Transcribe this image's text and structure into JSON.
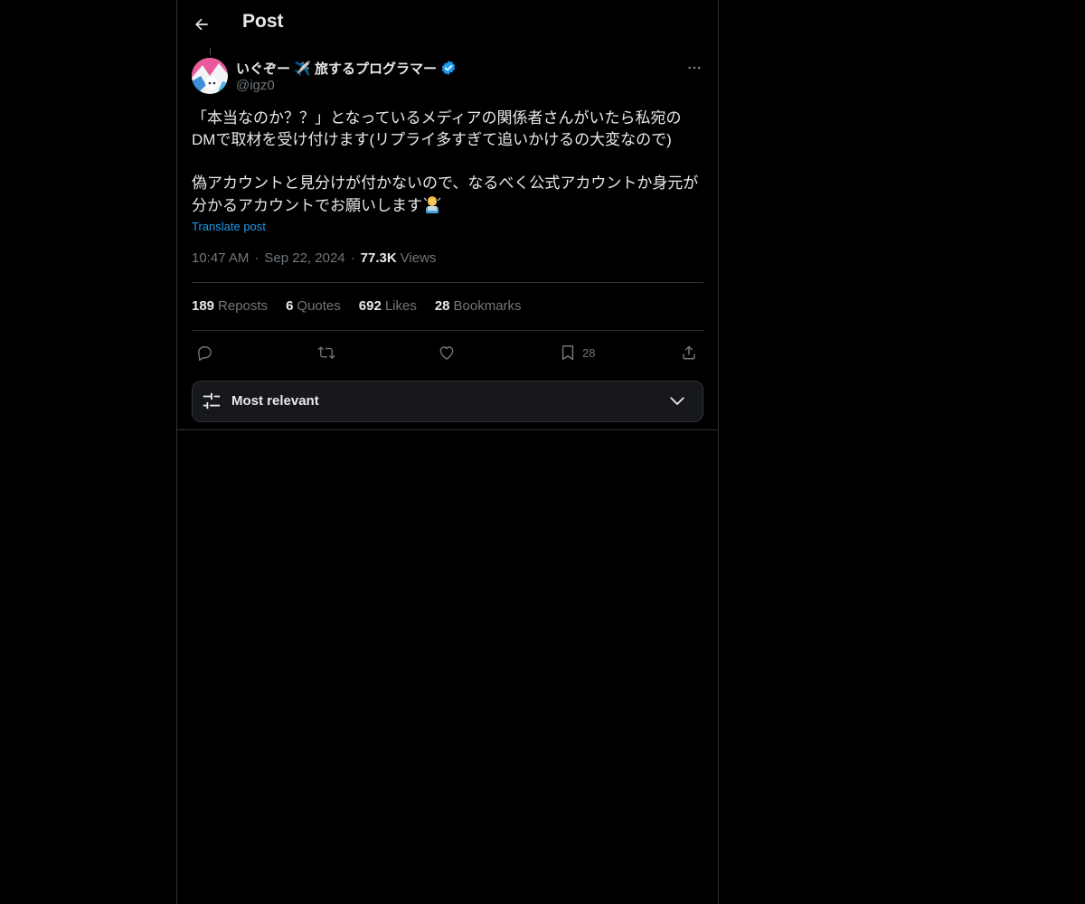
{
  "header": {
    "title": "Post"
  },
  "author": {
    "display_name": "いぐぞー ✈️ 旅するプログラマー",
    "handle": "@igz0"
  },
  "post": {
    "paragraph_1": "「本当なのか？？」となっているメディアの関係者さんがいたら私宛のDMで取材を受け付けます(リプライ多すぎて追いかけるの大変なので)",
    "paragraph_2": "偽アカウントと見分けが付かないので、なるべく公式アカウントか身元が分かるアカウントでお願いします",
    "translate_label": "Translate post",
    "time": "10:47 AM",
    "date": "Sep 22, 2024",
    "views_count": "77.3K",
    "views_label": "Views"
  },
  "stats": [
    {
      "count": "189",
      "label": "Reposts"
    },
    {
      "count": "6",
      "label": "Quotes"
    },
    {
      "count": "692",
      "label": "Likes"
    },
    {
      "count": "28",
      "label": "Bookmarks"
    }
  ],
  "actions": {
    "reply_icon": "reply-icon",
    "repost_icon": "repost-icon",
    "like_icon": "heart-icon",
    "bookmark_icon": "bookmark-icon",
    "bookmark_count": "28",
    "share_icon": "share-icon"
  },
  "sort": {
    "label": "Most relevant"
  },
  "colors": {
    "background": "#000000",
    "text": "#e7e9ea",
    "muted": "#71767b",
    "accent": "#1d9bf0",
    "border": "#2f3336"
  }
}
